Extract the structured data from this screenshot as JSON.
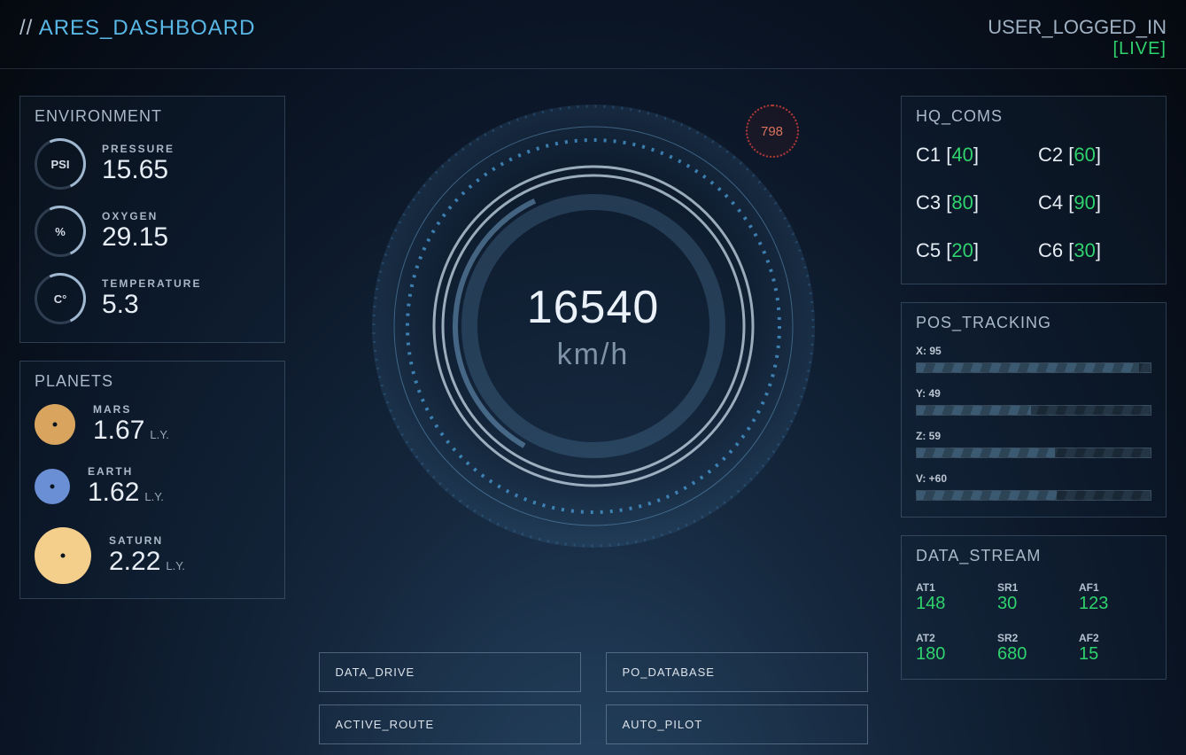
{
  "header": {
    "title": "ARES_DASHBOARD",
    "user_status": "USER_LOGGED_IN",
    "live_label": "[LIVE]"
  },
  "environment": {
    "title": "ENVIRONMENT",
    "items": [
      {
        "unit": "PSI",
        "label": "PRESSURE",
        "value": "15.65"
      },
      {
        "unit": "%",
        "label": "OXYGEN",
        "value": "29.15"
      },
      {
        "unit": "C°",
        "label": "TEMPERATURE",
        "value": "5.3"
      }
    ]
  },
  "planets": {
    "title": "PLANETS",
    "unit_label": "L.Y.",
    "items": [
      {
        "name": "MARS",
        "distance": "1.67",
        "color": "#d9a55e",
        "size": 46
      },
      {
        "name": "EARTH",
        "distance": "1.62",
        "color": "#6b8fd4",
        "size": 40
      },
      {
        "name": "SATURN",
        "distance": "2.22",
        "color": "#f4cf8c",
        "size": 64
      }
    ]
  },
  "gauge": {
    "speed": "16540",
    "unit": "km/h",
    "badge_value": "798"
  },
  "controls": {
    "buttons": [
      "DATA_DRIVE",
      "PO_DATABASE",
      "ACTIVE_ROUTE",
      "AUTO_PILOT"
    ]
  },
  "hq_coms": {
    "title": "HQ_COMS",
    "items": [
      {
        "name": "C1",
        "value": "40"
      },
      {
        "name": "C2",
        "value": "60"
      },
      {
        "name": "C3",
        "value": "80"
      },
      {
        "name": "C4",
        "value": "90"
      },
      {
        "name": "C5",
        "value": "20"
      },
      {
        "name": "C6",
        "value": "30"
      }
    ]
  },
  "pos_tracking": {
    "title": "POS_TRACKING",
    "rows": [
      {
        "label": "X: 95",
        "percent": 95
      },
      {
        "label": "Y: 49",
        "percent": 49
      },
      {
        "label": "Z: 59",
        "percent": 59
      },
      {
        "label": "V: +60",
        "percent": 60
      }
    ]
  },
  "data_stream": {
    "title": "DATA_STREAM",
    "cells": [
      {
        "k": "AT1",
        "v": "148"
      },
      {
        "k": "SR1",
        "v": "30"
      },
      {
        "k": "AF1",
        "v": "123"
      },
      {
        "k": "AT2",
        "v": "180"
      },
      {
        "k": "SR2",
        "v": "680"
      },
      {
        "k": "AF2",
        "v": "15"
      }
    ]
  }
}
